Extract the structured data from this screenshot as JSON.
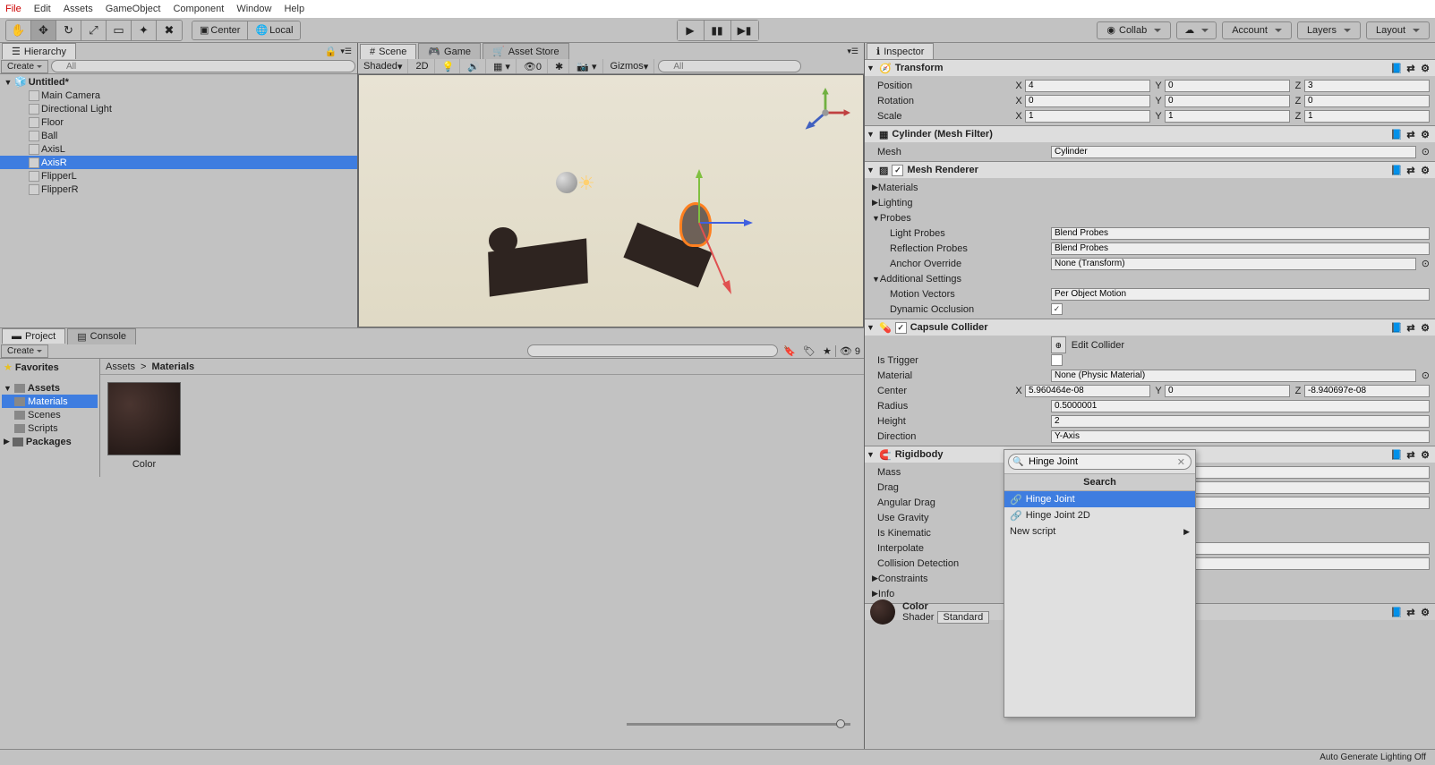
{
  "menu": {
    "file": "File",
    "edit": "Edit",
    "assets": "Assets",
    "gameObject": "GameObject",
    "component": "Component",
    "window": "Window",
    "help": "Help"
  },
  "toolbar": {
    "center": "Center",
    "local": "Local",
    "collab": "Collab",
    "account": "Account",
    "layers": "Layers",
    "layout": "Layout"
  },
  "hierarchy": {
    "title": "Hierarchy",
    "create": "Create",
    "searchPlaceholder": "All",
    "scene": "Untitled*",
    "items": [
      "Main Camera",
      "Directional Light",
      "Floor",
      "Ball",
      "AxisL",
      "AxisR",
      "FlipperL",
      "FlipperR"
    ],
    "selectedIndex": 5
  },
  "sceneTabs": {
    "scene": "Scene",
    "game": "Game",
    "assetStore": "Asset Store"
  },
  "sceneToolbar": {
    "shading": "Shaded",
    "mode2d": "2D",
    "gizmos": "Gizmos",
    "searchPlaceholder": "All"
  },
  "project": {
    "tabProject": "Project",
    "tabConsole": "Console",
    "create": "Create",
    "favorites": "Favorites",
    "tree": {
      "assets": "Assets",
      "materials": "Materials",
      "scenes": "Scenes",
      "scripts": "Scripts",
      "packages": "Packages"
    },
    "breadcrumb": [
      "Assets",
      "Materials"
    ],
    "assetName": "Color",
    "hiddenCount": "9"
  },
  "inspector": {
    "title": "Inspector",
    "transform": {
      "title": "Transform",
      "position": "Position",
      "rotation": "Rotation",
      "scale": "Scale",
      "pos": {
        "x": "4",
        "y": "0",
        "z": "3"
      },
      "rot": {
        "x": "0",
        "y": "0",
        "z": "0"
      },
      "scl": {
        "x": "1",
        "y": "1",
        "z": "1"
      }
    },
    "meshFilter": {
      "title": "Cylinder (Mesh Filter)",
      "meshLabel": "Mesh",
      "meshValue": "Cylinder"
    },
    "meshRenderer": {
      "title": "Mesh Renderer",
      "materials": "Materials",
      "lighting": "Lighting",
      "probes": "Probes",
      "lightProbes": "Light Probes",
      "lightProbesVal": "Blend Probes",
      "reflectionProbes": "Reflection Probes",
      "reflectionProbesVal": "Blend Probes",
      "anchorOverride": "Anchor Override",
      "anchorOverrideVal": "None (Transform)",
      "additional": "Additional Settings",
      "motionVectors": "Motion Vectors",
      "motionVectorsVal": "Per Object Motion",
      "dynamicOcclusion": "Dynamic Occlusion"
    },
    "capsule": {
      "title": "Capsule Collider",
      "editCollider": "Edit Collider",
      "isTrigger": "Is Trigger",
      "material": "Material",
      "materialVal": "None (Physic Material)",
      "center": "Center",
      "cx": "5.960464e-08",
      "cy": "0",
      "cz": "-8.940697e-08",
      "radius": "Radius",
      "radiusVal": "0.5000001",
      "height": "Height",
      "heightVal": "2",
      "direction": "Direction",
      "directionVal": "Y-Axis"
    },
    "rigidbody": {
      "title": "Rigidbody",
      "mass": "Mass",
      "drag": "Drag",
      "angularDrag": "Angular Drag",
      "useGravity": "Use Gravity",
      "isKinematic": "Is Kinematic",
      "interpolate": "Interpolate",
      "collisionDetection": "Collision Detection",
      "constraints": "Constraints",
      "info": "Info"
    },
    "material": {
      "colorLabel": "Color",
      "shaderLabel": "Shader",
      "shaderVal": "Standard"
    }
  },
  "searchPopup": {
    "query": "Hinge Joint",
    "header": "Search",
    "results": [
      "Hinge Joint",
      "Hinge Joint 2D",
      "New script"
    ],
    "selectedIndex": 0
  },
  "statusbar": {
    "lighting": "Auto Generate Lighting Off"
  }
}
